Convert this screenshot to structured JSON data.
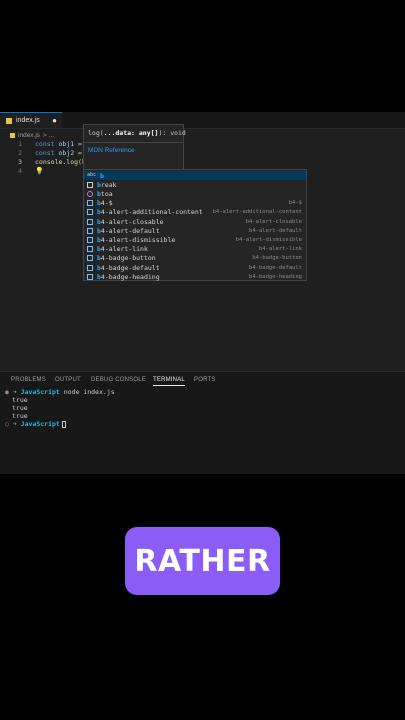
{
  "editor": {
    "tab": {
      "filename": "index.js",
      "dirty_marker": "●"
    },
    "breadcrumb": {
      "file": "index.js",
      "sep": "> ..."
    },
    "lines": [
      {
        "num": "1",
        "kw": "const",
        "rest": " obj1 ="
      },
      {
        "num": "2",
        "kw": "const",
        "rest": " obj2 ="
      },
      {
        "num": "3",
        "kw": "",
        "rest": "console.log(b)"
      },
      {
        "num": "4",
        "kw": "",
        "rest": ""
      }
    ],
    "lightbulb": "💡"
  },
  "signature": {
    "prefix": "log(",
    "param": "...data: any[]",
    "suffix": "): void",
    "link": "MDN Reference"
  },
  "suggestions": [
    {
      "icon": "abc",
      "label": "b",
      "detail": ""
    },
    {
      "icon": "keyword",
      "label": "break",
      "detail": ""
    },
    {
      "icon": "function",
      "label": "btoa",
      "detail": ""
    },
    {
      "icon": "snippet",
      "label": "b4-$",
      "detail": "b4-$"
    },
    {
      "icon": "snippet",
      "label": "b4-alert-additional-content",
      "detail": "b4-alert-additional-content"
    },
    {
      "icon": "snippet",
      "label": "b4-alert-closable",
      "detail": "b4-alert-closable"
    },
    {
      "icon": "snippet",
      "label": "b4-alert-default",
      "detail": "b4-alert-default"
    },
    {
      "icon": "snippet",
      "label": "b4-alert-dismissible",
      "detail": "b4-alert-dismissible"
    },
    {
      "icon": "snippet",
      "label": "b4-alert-link",
      "detail": "b4-alert-link"
    },
    {
      "icon": "snippet",
      "label": "b4-badge-button",
      "detail": "b4-badge-button"
    },
    {
      "icon": "snippet",
      "label": "b4-badge-default",
      "detail": "b4-badge-default"
    },
    {
      "icon": "snippet",
      "label": "b4-badge-heading",
      "detail": "b4-badge-heading"
    }
  ],
  "panel": {
    "tabs": [
      "PROBLEMS",
      "OUTPUT",
      "DEBUG CONSOLE",
      "TERMINAL",
      "PORTS"
    ],
    "active_tab": "TERMINAL"
  },
  "terminal": {
    "prompt_arrow": "➜",
    "project": "JavaScript",
    "command": "node index.js",
    "output": [
      "true",
      "true",
      "true"
    ]
  },
  "caption": "RATHER"
}
